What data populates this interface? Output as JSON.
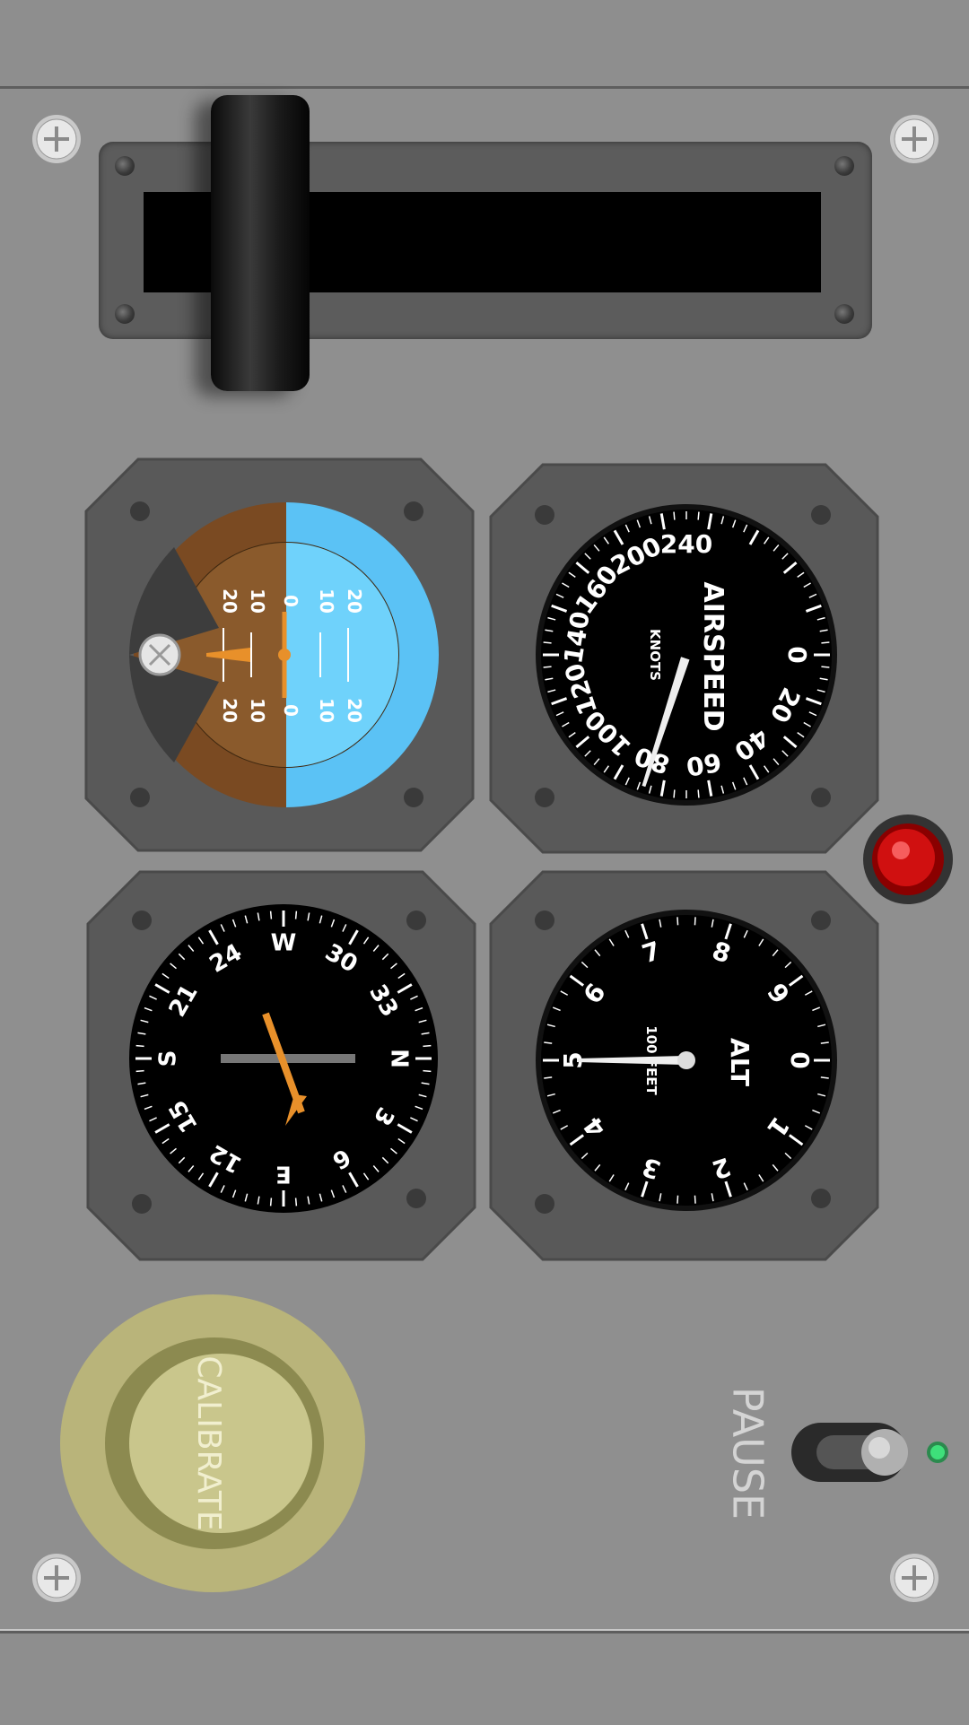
{
  "app": {
    "title": ""
  },
  "throttle": {
    "level_percent": 0
  },
  "attitude_indicator": {
    "pitch_marks_left": [
      "20",
      "10",
      "0",
      "10",
      "20"
    ],
    "pitch_marks_right": [
      "20",
      "10",
      "0",
      "10",
      "20"
    ],
    "sky_color": "#5bc2f5",
    "ground_color": "#7a4a22"
  },
  "airspeed_indicator": {
    "title": "AIRSPEED",
    "unit": "KNOTS",
    "scale_labels": [
      "0",
      "20",
      "40",
      "60",
      "80",
      "100",
      "120",
      "140",
      "160",
      "200",
      "240"
    ],
    "needle_value": 80
  },
  "heading_indicator": {
    "labels": [
      "N",
      "3",
      "6",
      "E",
      "12",
      "15",
      "S",
      "21",
      "24",
      "W",
      "30",
      "33"
    ]
  },
  "altimeter": {
    "title": "ALT",
    "unit": "100 FEET",
    "scale_labels": [
      "0",
      "1",
      "2",
      "3",
      "4",
      "5",
      "6",
      "7",
      "8",
      "9"
    ],
    "needle_value": 5
  },
  "warning_light": {
    "color": "#d01010",
    "state": "on"
  },
  "calibrate_button": {
    "label": "CALIBRATE",
    "color": "#b9b47a"
  },
  "pause_switch": {
    "label": "PAUSE",
    "state": "off",
    "indicator_color": "#3ee07a"
  }
}
